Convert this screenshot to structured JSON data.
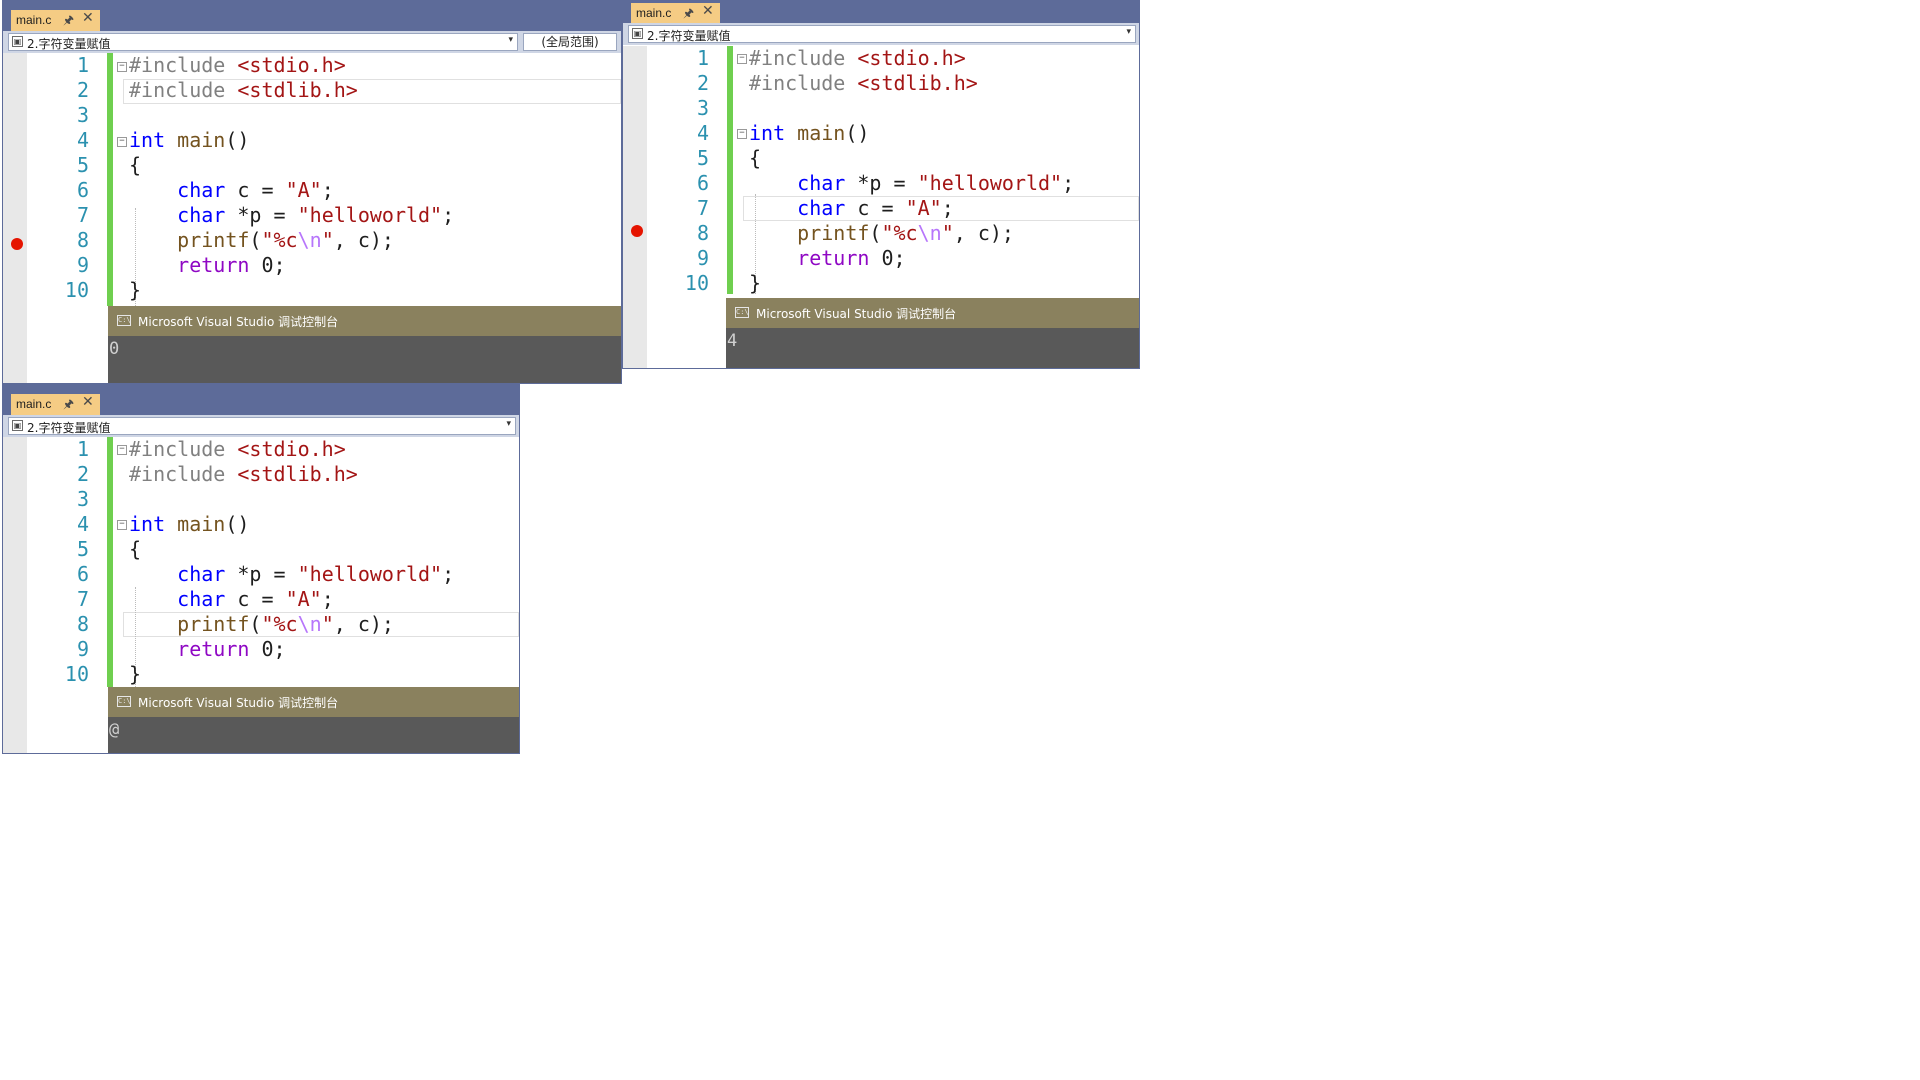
{
  "panels": [
    {
      "tab_label": "main.c",
      "scope_selector": "2.字符变量赋值",
      "global_scope": "(全局范围)",
      "line_numbers": [
        "1",
        "2",
        "3",
        "4",
        "5",
        "6",
        "7",
        "8",
        "9",
        "10"
      ],
      "code": {
        "inc1_directive": "#include",
        "inc1_header": "<stdio.h>",
        "inc2_directive": "#include",
        "inc2_header": "<stdlib.h>",
        "main_type": "int",
        "main_name": "main",
        "main_parens": "()",
        "open_brace": "{",
        "l6_type": "char",
        "l6_decl": "c = ",
        "l6_str": "\"A\"",
        "l6_end": ";",
        "l7_type": "char",
        "l7_decl": "*p = ",
        "l7_str": "\"helloworld\"",
        "l7_end": ";",
        "pf_name": "printf",
        "pf_open": "(",
        "pf_str_a": "\"%c",
        "pf_esc": "\\n",
        "pf_str_b": "\"",
        "pf_rest": ", c);",
        "ret_kw": "return",
        "ret_rest": " 0;",
        "close_brace": "}"
      },
      "console_title": "Microsoft Visual Studio 调试控制台",
      "console_output": "0"
    },
    {
      "tab_label": "main.c",
      "scope_selector": "2.字符变量赋值",
      "line_numbers": [
        "1",
        "2",
        "3",
        "4",
        "5",
        "6",
        "7",
        "8",
        "9",
        "10"
      ],
      "code": {
        "inc1_directive": "#include",
        "inc1_header": "<stdio.h>",
        "inc2_directive": "#include",
        "inc2_header": "<stdlib.h>",
        "main_type": "int",
        "main_name": "main",
        "main_parens": "()",
        "open_brace": "{",
        "l6_type": "char",
        "l6_decl": "*p = ",
        "l6_str": "\"helloworld\"",
        "l6_end": ";",
        "l7_type": "char",
        "l7_decl": "c = ",
        "l7_str": "\"A\"",
        "l7_end": ";",
        "pf_name": "printf",
        "pf_open": "(",
        "pf_str_a": "\"%c",
        "pf_esc": "\\n",
        "pf_str_b": "\"",
        "pf_rest": ", c);",
        "ret_kw": "return",
        "ret_rest": " 0;",
        "close_brace": "}"
      },
      "console_title": "Microsoft Visual Studio 调试控制台",
      "console_output": "4"
    },
    {
      "tab_label": "main.c",
      "scope_selector": "2.字符变量赋值",
      "line_numbers": [
        "1",
        "2",
        "3",
        "4",
        "5",
        "6",
        "7",
        "8",
        "9",
        "10"
      ],
      "code": {
        "inc1_directive": "#include",
        "inc1_header": "<stdio.h>",
        "inc2_directive": "#include",
        "inc2_header": "<stdlib.h>",
        "main_type": "int",
        "main_name": "main",
        "main_parens": "()",
        "open_brace": "{",
        "l6_type": "char",
        "l6_decl": "*p = ",
        "l6_str": "\"helloworld\"",
        "l6_end": ";",
        "l7_type": "char",
        "l7_decl": "c = ",
        "l7_str": "\"A\"",
        "l7_end": ";",
        "pf_name": "printf",
        "pf_open": "(",
        "pf_str_a": "\"%c",
        "pf_esc": "\\n",
        "pf_str_b": "\"",
        "pf_rest": ", c);",
        "ret_kw": "return",
        "ret_rest": " 0;",
        "close_brace": "}"
      },
      "console_title": "Microsoft Visual Studio 调试控制台",
      "console_output": "@"
    }
  ],
  "colors": {
    "keyword": "#0000ff",
    "preprocessor": "#808080",
    "string": "#a31515",
    "function": "#74531f",
    "escape": "#b776fb",
    "control": "#8f08c4",
    "line_number": "#2b91af",
    "breakpoint": "#e51400",
    "change_bar": "#6fcf4f",
    "tab_bar": "#5d6b99",
    "active_tab": "#f5cc84",
    "console_title_bar": "#8a815e",
    "console_body": "#595959"
  }
}
